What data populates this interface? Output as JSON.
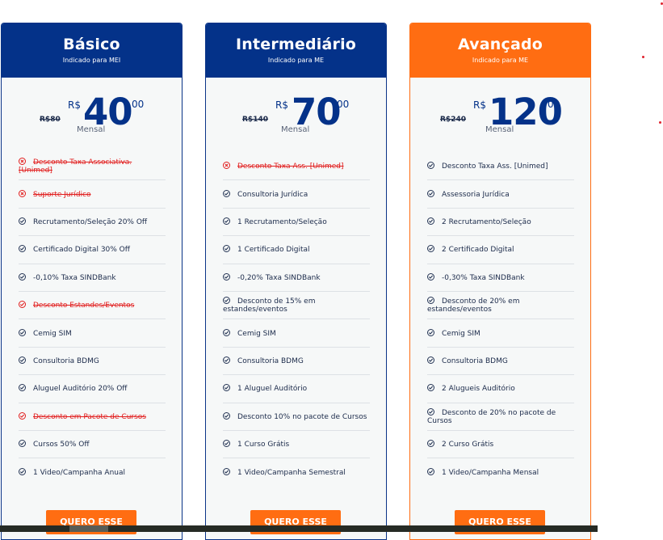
{
  "plans": [
    {
      "name": "Básico",
      "subtitle": "Indicado para MEI",
      "old_price": "R$80",
      "currency": "R$",
      "amount": "40",
      "cents": "00",
      "period": "Mensal",
      "features": [
        {
          "text": "Desconto Taxa Associativa. [Unimed]",
          "included": false,
          "icon": "x-circle-icon"
        },
        {
          "text": "Suporte Jurídico",
          "included": false,
          "icon": "x-circle-icon"
        },
        {
          "text": "Recrutamento/Seleção 20% Off",
          "included": true,
          "icon": "check-circle-icon"
        },
        {
          "text": "Certificado Digital 30% Off",
          "included": true,
          "icon": "check-circle-icon"
        },
        {
          "text": "-0,10% Taxa SINDBank",
          "included": true,
          "icon": "check-circle-icon"
        },
        {
          "text": "Desconto Estandes/Eventos",
          "included": false,
          "icon": "check-circle-icon"
        },
        {
          "text": "Cemig SIM",
          "included": true,
          "icon": "check-circle-icon"
        },
        {
          "text": "Consultoria BDMG",
          "included": true,
          "icon": "check-circle-icon"
        },
        {
          "text": "Aluguel Auditório 20% Off",
          "included": true,
          "icon": "check-circle-icon"
        },
        {
          "text": "Desconto em Pacote de Cursos",
          "included": false,
          "icon": "check-circle-icon"
        },
        {
          "text": "Cursos 50% Off",
          "included": true,
          "icon": "check-circle-icon"
        },
        {
          "text": "1 Video/Campanha Anual",
          "included": true,
          "icon": "check-circle-icon"
        }
      ],
      "button": "QUERO ESSE"
    },
    {
      "name": "Intermediário",
      "subtitle": "Indicado para ME",
      "old_price": "R$140",
      "currency": "R$",
      "amount": "70",
      "cents": "00",
      "period": "Mensal",
      "features": [
        {
          "text": "Desconto Taxa Ass. [Unimed]",
          "included": false,
          "icon": "x-circle-icon"
        },
        {
          "text": "Consultoria Jurídica",
          "included": true,
          "icon": "check-circle-icon"
        },
        {
          "text": "1 Recrutamento/Seleção",
          "included": true,
          "icon": "check-circle-icon"
        },
        {
          "text": "1 Certificado Digital",
          "included": true,
          "icon": "check-circle-icon"
        },
        {
          "text": "-0,20% Taxa SINDBank",
          "included": true,
          "icon": "check-circle-icon"
        },
        {
          "text": "Desconto de 15% em estandes/eventos",
          "included": true,
          "icon": "check-circle-icon"
        },
        {
          "text": "Cemig SIM",
          "included": true,
          "icon": "check-circle-icon"
        },
        {
          "text": "Consultoria BDMG",
          "included": true,
          "icon": "check-circle-icon"
        },
        {
          "text": "1 Aluguel Auditório",
          "included": true,
          "icon": "check-circle-icon"
        },
        {
          "text": "Desconto 10% no pacote de Cursos",
          "included": true,
          "icon": "check-circle-icon"
        },
        {
          "text": "1 Curso Grátis",
          "included": true,
          "icon": "check-circle-icon"
        },
        {
          "text": "1 Video/Campanha Semestral",
          "included": true,
          "icon": "check-circle-icon"
        }
      ],
      "button": "QUERO ESSE"
    },
    {
      "name": "Avançado",
      "subtitle": "Indicado para ME",
      "old_price": "R$240",
      "currency": "R$",
      "amount": "120",
      "cents": "00",
      "period": "Mensal",
      "features": [
        {
          "text": "Desconto Taxa Ass. [Unimed]",
          "included": true,
          "icon": "check-circle-icon"
        },
        {
          "text": "Assessoria Jurídica",
          "included": true,
          "icon": "check-circle-icon"
        },
        {
          "text": "2 Recrutamento/Seleção",
          "included": true,
          "icon": "check-circle-icon"
        },
        {
          "text": "2 Certificado Digital",
          "included": true,
          "icon": "check-circle-icon"
        },
        {
          "text": "-0,30% Taxa SINDBank",
          "included": true,
          "icon": "check-circle-icon"
        },
        {
          "text": "Desconto de 20% em estandes/eventos",
          "included": true,
          "icon": "check-circle-icon"
        },
        {
          "text": "Cemig SIM",
          "included": true,
          "icon": "check-circle-icon"
        },
        {
          "text": "Consultoria BDMG",
          "included": true,
          "icon": "check-circle-icon"
        },
        {
          "text": "2 Alugueis Auditório",
          "included": true,
          "icon": "check-circle-icon"
        },
        {
          "text": "Desconto de 20% no pacote de Cursos",
          "included": true,
          "icon": "check-circle-icon"
        },
        {
          "text": "2 Curso Grátis",
          "included": true,
          "icon": "check-circle-icon"
        },
        {
          "text": "1 Video/Campanha Mensal",
          "included": true,
          "icon": "check-circle-icon"
        }
      ],
      "button": "QUERO ESSE"
    }
  ],
  "colors": {
    "primary": "#043289",
    "accent": "#ff6d12",
    "strike": "#e11c1c",
    "card_bg": "#f6f8f8"
  }
}
